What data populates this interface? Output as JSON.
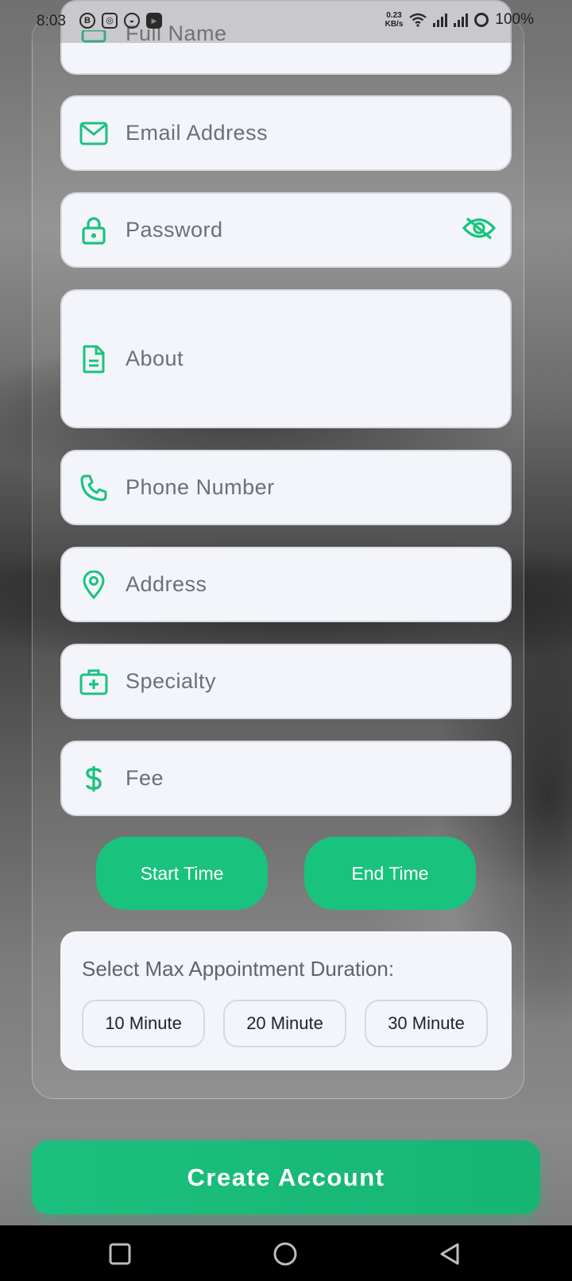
{
  "status_bar": {
    "time": "8:03",
    "net_speed_value": "0.23",
    "net_speed_unit": "KB/s",
    "battery": "100%"
  },
  "form": {
    "full_name_placeholder": "Full Name",
    "email_placeholder": "Email Address",
    "password_placeholder": "Password",
    "about_placeholder": "About",
    "phone_placeholder": "Phone Number",
    "address_placeholder": "Address",
    "specialty_placeholder": "Specialty",
    "fee_placeholder": "Fee"
  },
  "time_buttons": {
    "start_label": "Start Time",
    "end_label": "End Time"
  },
  "duration": {
    "title": "Select Max Appointment Duration:",
    "options": [
      "10 Minute",
      "20 Minute",
      "30 Minute"
    ]
  },
  "create_account_label": "Create Account",
  "colors": {
    "accent": "#19c37d",
    "field_bg": "#f4f5fa",
    "placeholder_text": "#6b6f7a"
  },
  "icons": {
    "full_name": "person-icon",
    "email": "mail-icon",
    "password": "lock-icon",
    "password_toggle": "eye-off-icon",
    "about": "document-icon",
    "phone": "phone-icon",
    "address": "location-pin-icon",
    "specialty": "medical-bag-icon",
    "fee": "dollar-icon"
  }
}
